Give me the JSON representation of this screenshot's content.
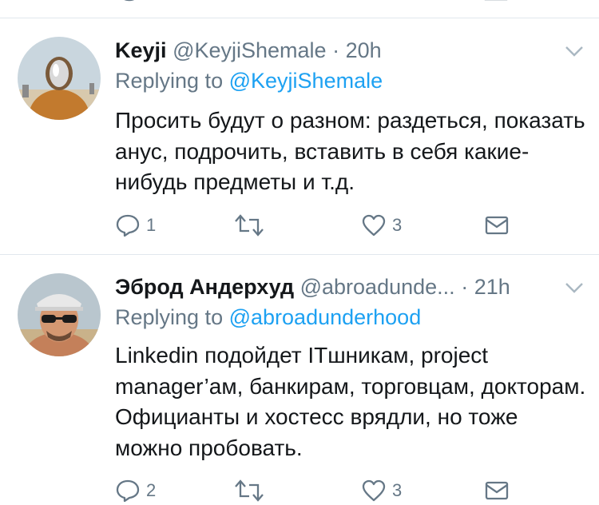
{
  "theme": {
    "secondary": "#657786",
    "accent": "#1da1f2",
    "divider": "#e1e8ed",
    "text": "#14171a"
  },
  "tweets": [
    {
      "name": "Keyji",
      "handle": "@KeyjiShemale",
      "separator": "·",
      "time": "20h",
      "replying_prefix": "Replying to",
      "replying_to": "@KeyjiShemale",
      "body": "Просить будут о разном: раздеться, показать анус, подрочить, вставить в себя какие-нибудь предметы и т.д.",
      "reply_count": "1",
      "retweet_count": "",
      "like_count": "3",
      "avatar_icon": "avatar-masked-person"
    },
    {
      "name": "Эброд Андерхуд",
      "handle": "@abroadunde...",
      "separator": "·",
      "time": "21h",
      "replying_prefix": "Replying to",
      "replying_to": "@abroadunderhood",
      "body": "Linkedin подойдет ITшникам, project manager’ам, банкирам, торговцам, докторам. Официанты и хостесс врядли, но тоже можно пробовать.",
      "reply_count": "2",
      "retweet_count": "",
      "like_count": "3",
      "avatar_icon": "avatar-man-sunglasses"
    }
  ]
}
